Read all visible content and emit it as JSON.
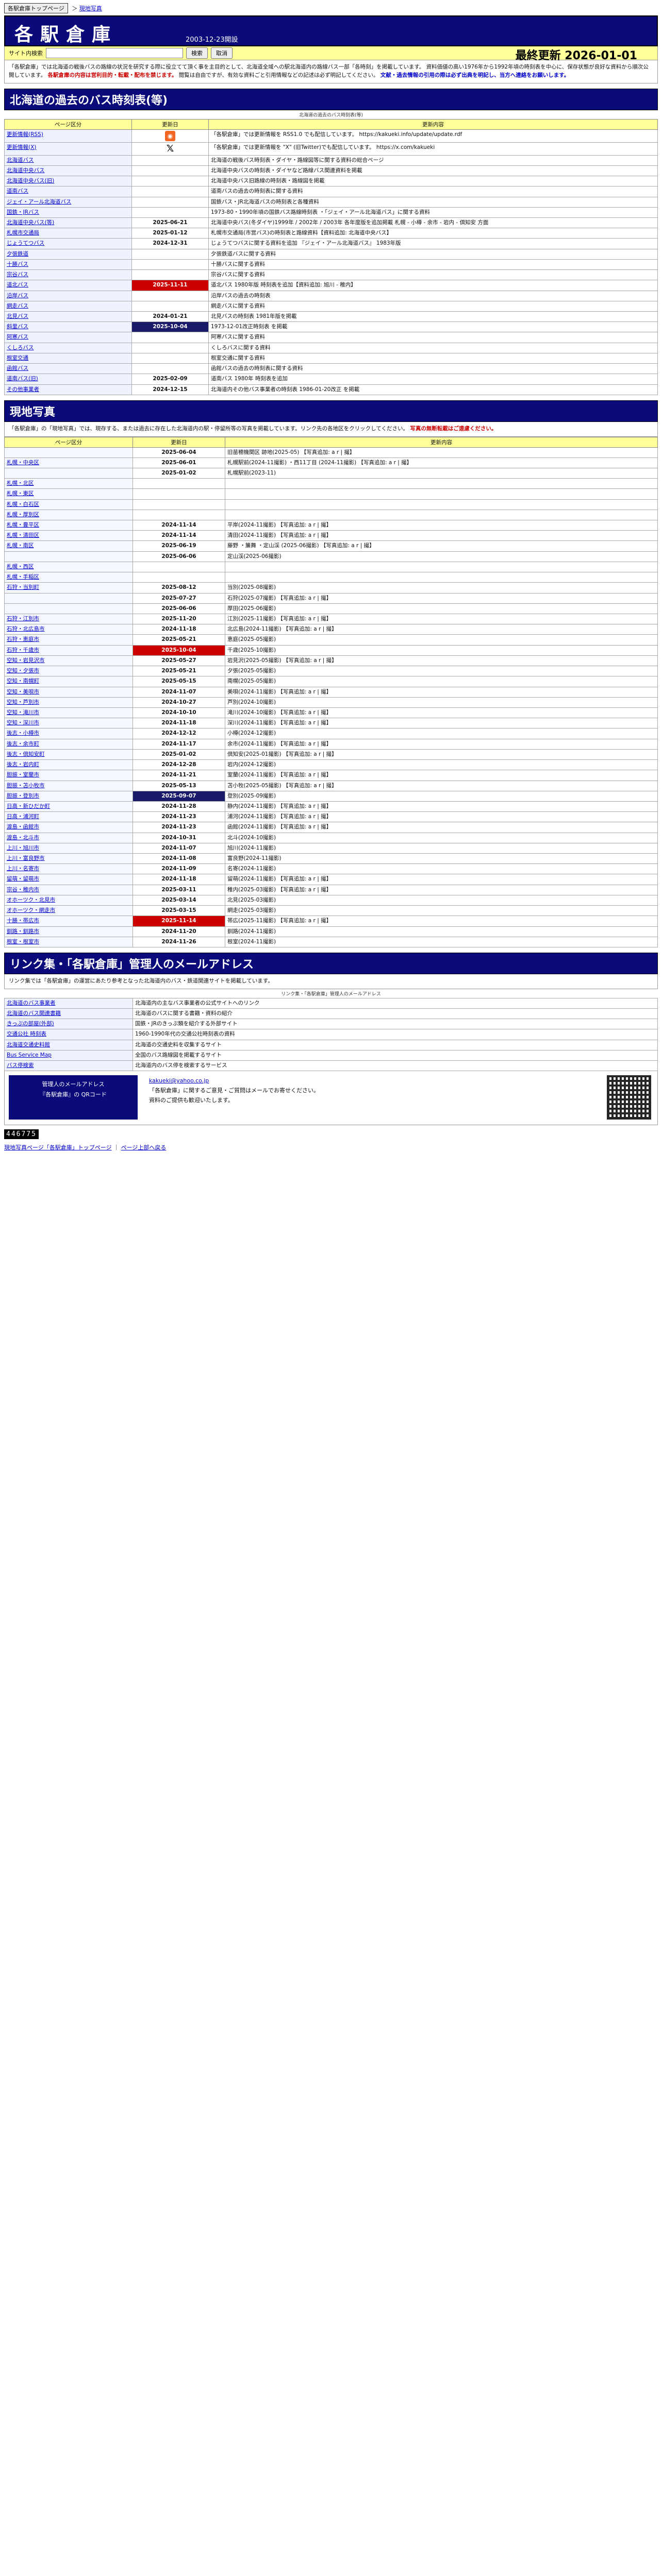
{
  "crumb": {
    "home": "各駅倉庫トップページ",
    "sep": "＞",
    "current": "現地写真"
  },
  "header": {
    "title": "各駅倉庫",
    "since": "2003-12-23開設",
    "search_label": "サイト内検索",
    "search_placeholder": "",
    "search_button": "検索",
    "clear_button": "取消",
    "last_update_label": "最終更新",
    "last_update": "2026-01-01"
  },
  "notice": {
    "line1": "「各駅倉庫」では北海道の戦後バスの路線の状況を研究する際に役立てて頂く事を主目的として、北海道全域への駅北海道内の路線バス一部「各時刻」を掲載しています。",
    "line2": "資料価値の高い1976年から1992年頃の時刻表を中心に、保存状態が良好な資料から順次公開しています。",
    "red": "各駅倉庫の内容は営利目的・転載・配布を禁じます。",
    "line3": "閲覧は自由ですが、有効な資料ごと引用情報などの記述は必ず明記してください。",
    "blue": "文献・過去情報の引用の際は必ず出典を明記し、当方へ連絡をお願いします。"
  },
  "bus": {
    "banner": "北海道の過去のバス時刻表(等)",
    "sub": "北海道の過去のバス時刻表(等)",
    "headers": [
      "ページ区分",
      "更新日",
      "更新内容"
    ],
    "rows": [
      {
        "cat": "更新情報(RSS)",
        "date": "",
        "icon": "rss",
        "text": "「各駅倉庫」では更新情報を RSS1.0 でも配信しています。 https://kakueki.info/update/update.rdf"
      },
      {
        "cat": "更新情報(X)",
        "date": "",
        "icon": "x",
        "text": "「各駅倉庫」では更新情報を \"X\" (旧Twitter)でも配信しています。 https://x.com/kakueki"
      },
      {
        "cat": "北海道バス",
        "date": "",
        "text": "北海道の戦後バス時刻表・ダイヤ・路線図等に関する資料の総合ページ"
      },
      {
        "cat": "北海道中央バス",
        "date": "",
        "text": "北海道中央バスの時刻表・ダイヤなど路線バス関連資料を掲載"
      },
      {
        "cat": "北海道中央バス(旧)",
        "date": "",
        "text": "北海道中央バス旧路線の時刻表・路線図を掲載"
      },
      {
        "cat": "道南バス",
        "date": "",
        "text": "道南バスの過去の時刻表に関する資料"
      },
      {
        "cat": "ジェイ・アール北海道バス",
        "date": "",
        "text": "国鉄バス・JR北海道バスの時刻表と各種資料"
      },
      {
        "cat": "国鉄・JRバス",
        "date": "",
        "text": "1973-80・1990年頃の国鉄バス路線時刻表 ・「ジェイ・アール北海道バス」に関する資料"
      },
      {
        "cat": "北海道中央バス(等)",
        "date": "2025-06-21",
        "text": "北海道中央バス(冬ダイヤ)1999年 / 2002年 / 2003年 各年度版を追加掲載 札幌 - 小樽 - 余市 - 岩内 - 倶知安 方面"
      },
      {
        "cat": "札幌市交通局",
        "date": "2025-01-12",
        "text": "札幌市交通局(市営バス)の時刻表と路線資料【資料追加: 北海道中央バス】"
      },
      {
        "cat": "じょうてつバス",
        "date": "2024-12-31",
        "text": "じょうてつバスに関する資料を追加 『ジェイ・アール北海道バス』 1983年版"
      },
      {
        "cat": "夕張鉄道",
        "date": "",
        "text": "夕張鉄道バスに関する資料"
      },
      {
        "cat": "十勝バス",
        "date": "",
        "text": "十勝バスに関する資料"
      },
      {
        "cat": "宗谷バス",
        "date": "",
        "text": "宗谷バスに関する資料"
      },
      {
        "cat": "道北バス",
        "date": "2025-11-11",
        "hl": "red",
        "text": "道北バス 1980年版 時刻表を追加【資料追加: 旭川 - 稚内】"
      },
      {
        "cat": "沿岸バス",
        "date": "",
        "text": "沿岸バスの過去の時刻表"
      },
      {
        "cat": "網走バス",
        "date": "",
        "text": "網走バスに関する資料"
      },
      {
        "cat": "北見バス",
        "date": "2024-01-21",
        "text": "北見バスの時刻表 1981年版を掲載"
      },
      {
        "cat": "斜里バス",
        "date": "2025-10-04",
        "hl": "navy",
        "text": "1973-12-01改正時刻表 を掲載"
      },
      {
        "cat": "阿寒バス",
        "date": "",
        "text": "阿寒バスに関する資料"
      },
      {
        "cat": "くしろバス",
        "date": "",
        "text": "くしろバスに関する資料"
      },
      {
        "cat": "根室交通",
        "date": "",
        "text": "根室交通に関する資料"
      },
      {
        "cat": "函館バス",
        "date": "",
        "text": "函館バスの過去の時刻表に関する資料"
      },
      {
        "cat": "道南バス(旧)",
        "date": "2025-02-09",
        "text": "道南バス 1980年 時刻表を追加"
      },
      {
        "cat": "その他事業者",
        "date": "2024-12-15",
        "text": "北海道内その他バス事業者の時刻表 1986-01-20改正 を掲載"
      }
    ]
  },
  "photos": {
    "banner": "現地写真",
    "intro": "「各駅倉庫」の「現地写真」では、現存する、または過去に存在した北海道内の駅・停留所等の写真を掲載しています。リンク先の各地区をクリックしてください。",
    "intro_red": "写真の無断転載はご遠慮ください。",
    "headers": [
      "ページ区分",
      "更新日",
      "更新内容"
    ],
    "rows": [
      {
        "cat": "",
        "date": "2025-06-04",
        "text": "旧苗穂機関区 跡地(2025-05) 【写真追加: a r | 撮】"
      },
      {
        "cat": "札幌・中央区",
        "date": "2025-06-01",
        "text": "札幌駅前(2024-11撮影) ・西11丁目 (2024-11撮影) 【写真追加: a r | 撮】"
      },
      {
        "cat": "",
        "date": "2025-01-02",
        "text": "札幌駅前(2023-11)"
      },
      {
        "cat": "札幌・北区",
        "date": "",
        "text": ""
      },
      {
        "cat": "札幌・東区",
        "date": "",
        "text": ""
      },
      {
        "cat": "札幌・白石区",
        "date": "",
        "text": ""
      },
      {
        "cat": "札幌・厚別区",
        "date": "",
        "text": ""
      },
      {
        "cat": "札幌・豊平区",
        "date": "2024-11-14",
        "text": "平岸(2024-11撮影) 【写真追加: a r | 撮】"
      },
      {
        "cat": "札幌・清田区",
        "date": "2024-11-14",
        "text": "清田(2024-11撮影) 【写真追加: a r | 撮】"
      },
      {
        "cat": "札幌・南区",
        "date": "2025-06-19",
        "text": "藤野 ・簾舞 ・定山渓 (2025-06撮影) 【写真追加: a r | 撮】"
      },
      {
        "cat": "",
        "date": "2025-06-06",
        "text": "定山渓(2025-06撮影)"
      },
      {
        "cat": "札幌・西区",
        "date": "",
        "text": ""
      },
      {
        "cat": "札幌・手稲区",
        "date": "",
        "text": ""
      },
      {
        "cat": "石狩・当別町",
        "date": "2025-08-12",
        "text": "当別(2025-08撮影)"
      },
      {
        "cat": "",
        "date": "2025-07-27",
        "text": "石狩(2025-07撮影) 【写真追加: a r | 撮】"
      },
      {
        "cat": "",
        "date": "2025-06-06",
        "text": "厚田(2025-06撮影)"
      },
      {
        "cat": "石狩・江別市",
        "date": "2025-11-20",
        "text": "江別(2025-11撮影) 【写真追加: a r | 撮】"
      },
      {
        "cat": "石狩・北広島市",
        "date": "2024-11-18",
        "text": "北広島(2024-11撮影) 【写真追加: a r | 撮】"
      },
      {
        "cat": "石狩・恵庭市",
        "date": "2025-05-21",
        "text": "恵庭(2025-05撮影)"
      },
      {
        "cat": "石狩・千歳市",
        "date": "2025-10-04",
        "hl": "red",
        "text": "千歳(2025-10撮影)"
      },
      {
        "cat": "空知・岩見沢市",
        "date": "2025-05-27",
        "text": "岩見沢(2025-05撮影) 【写真追加: a r | 撮】"
      },
      {
        "cat": "空知・夕張市",
        "date": "2025-05-21",
        "text": "夕張(2025-05撮影)"
      },
      {
        "cat": "空知・南幌町",
        "date": "2025-05-15",
        "text": "南幌(2025-05撮影)"
      },
      {
        "cat": "空知・美唄市",
        "date": "2024-11-07",
        "text": "美唄(2024-11撮影) 【写真追加: a r | 撮】"
      },
      {
        "cat": "空知・芦別市",
        "date": "2024-10-27",
        "text": "芦別(2024-10撮影)"
      },
      {
        "cat": "空知・滝川市",
        "date": "2024-10-10",
        "text": "滝川(2024-10撮影) 【写真追加: a r | 撮】"
      },
      {
        "cat": "空知・深川市",
        "date": "2024-11-18",
        "text": "深川(2024-11撮影) 【写真追加: a r | 撮】"
      },
      {
        "cat": "後志・小樽市",
        "date": "2024-12-12",
        "text": "小樽(2024-12撮影)"
      },
      {
        "cat": "後志・余市町",
        "date": "2024-11-17",
        "text": "余市(2024-11撮影) 【写真追加: a r | 撮】"
      },
      {
        "cat": "後志・倶知安町",
        "date": "2025-01-02",
        "text": "倶知安(2025-01撮影) 【写真追加: a r | 撮】"
      },
      {
        "cat": "後志・岩内町",
        "date": "2024-12-28",
        "text": "岩内(2024-12撮影)"
      },
      {
        "cat": "胆振・室蘭市",
        "date": "2024-11-21",
        "text": "室蘭(2024-11撮影) 【写真追加: a r | 撮】"
      },
      {
        "cat": "胆振・苫小牧市",
        "date": "2025-05-13",
        "text": "苫小牧(2025-05撮影) 【写真追加: a r | 撮】"
      },
      {
        "cat": "胆振・登別市",
        "date": "2025-09-07",
        "hl": "navy",
        "text": "登別(2025-09撮影)"
      },
      {
        "cat": "日高・新ひだか町",
        "date": "2024-11-28",
        "text": "静内(2024-11撮影) 【写真追加: a r | 撮】"
      },
      {
        "cat": "日高・浦河町",
        "date": "2024-11-23",
        "text": "浦河(2024-11撮影) 【写真追加: a r | 撮】"
      },
      {
        "cat": "渡島・函館市",
        "date": "2024-11-23",
        "text": "函館(2024-11撮影) 【写真追加: a r | 撮】"
      },
      {
        "cat": "渡島・北斗市",
        "date": "2024-10-31",
        "text": "北斗(2024-10撮影)"
      },
      {
        "cat": "上川・旭川市",
        "date": "2024-11-07",
        "text": "旭川(2024-11撮影)"
      },
      {
        "cat": "上川・富良野市",
        "date": "2024-11-08",
        "text": "富良野(2024-11撮影)"
      },
      {
        "cat": "上川・名寄市",
        "date": "2024-11-09",
        "text": "名寄(2024-11撮影)"
      },
      {
        "cat": "留萌・留萌市",
        "date": "2024-11-18",
        "text": "留萌(2024-11撮影) 【写真追加: a r | 撮】"
      },
      {
        "cat": "宗谷・稚内市",
        "date": "2025-03-11",
        "text": "稚内(2025-03撮影) 【写真追加: a r | 撮】"
      },
      {
        "cat": "オホーツク・北見市",
        "date": "2025-03-14",
        "text": "北見(2025-03撮影)"
      },
      {
        "cat": "オホーツク・網走市",
        "date": "2025-03-15",
        "text": "網走(2025-03撮影)"
      },
      {
        "cat": "十勝・帯広市",
        "date": "2025-11-14",
        "hl": "red",
        "text": "帯広(2025-11撮影) 【写真追加: a r | 撮】"
      },
      {
        "cat": "釧路・釧路市",
        "date": "2024-11-20",
        "text": "釧路(2024-11撮影)"
      },
      {
        "cat": "根室・根室市",
        "date": "2024-11-26",
        "text": "根室(2024-11撮影)"
      }
    ]
  },
  "links": {
    "banner": "リンク集・「各駅倉庫」管理人のメールアドレス",
    "intro": "リンク集では「各駅倉庫」の運営にあたり参考となった北海道内のバス・鉄道関連サイトを掲載しています。",
    "sub": "リンク集・「各駅倉庫」管理人のメールアドレス",
    "rows": [
      {
        "cat": "北海道のバス事業者",
        "text": "北海道内の主なバス事業者の公式サイトへのリンク"
      },
      {
        "cat": "北海道のバス関連書籍",
        "text": "北海道のバスに関する書籍・資料の紹介"
      },
      {
        "cat": "きっぷの部屋(外部)",
        "text": "国鉄・JRのきっぷ類を紹介する外部サイト"
      },
      {
        "cat": "交通公社 時刻表",
        "text": "1960-1990年代の交通公社時刻表の資料"
      },
      {
        "cat": "北海道交通史料館",
        "text": "北海道の交通史料を収集するサイト"
      },
      {
        "cat": "Bus Service Map",
        "text": "全国のバス路線図を掲載するサイト"
      },
      {
        "cat": "バス停検索",
        "text": "北海道内のバス停を検索するサービス"
      }
    ],
    "mail_left_1": "管理人のメールアドレス",
    "mail_left_2": "『各駅倉庫』の QRコード",
    "mail_addr": "kakueki@yahoo.co.jp",
    "mail_note_1": "「各駅倉庫」に関するご意見・ご質問はメールでお寄せください。",
    "mail_note_2": "資料のご提供も歓迎いたします。"
  },
  "counter": "446775",
  "footer": {
    "home": "現地写真ページ「各駅倉庫」トップページ",
    "sep": "｜",
    "top": "ページ上部へ戻る"
  }
}
